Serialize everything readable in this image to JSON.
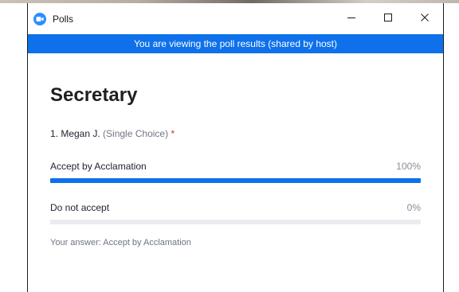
{
  "window": {
    "title": "Polls",
    "controls": [
      "minimize",
      "maximize",
      "close"
    ]
  },
  "banner": {
    "text": "You are viewing the poll results (shared by host)"
  },
  "poll": {
    "title": "Secretary",
    "question": {
      "number_name": "1. Megan J.",
      "type": "(Single Choice)",
      "required_mark": "*"
    },
    "answers": [
      {
        "label": "Accept by Acclamation",
        "percent_text": "100%",
        "percent": 100
      },
      {
        "label": "Do not accept",
        "percent_text": "0%",
        "percent": 0
      }
    ],
    "your_answer": "Your answer: Accept by Acclamation"
  },
  "colors": {
    "accent": "#0e71eb",
    "track": "#ececf0",
    "required": "#e02828"
  },
  "icons": {
    "app": "zoom-camera-icon",
    "minimize": "minimize-icon",
    "maximize": "maximize-icon",
    "close": "close-icon"
  }
}
